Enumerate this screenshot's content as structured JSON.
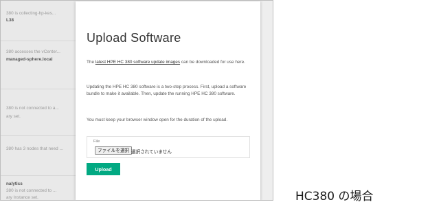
{
  "background_list": {
    "items": [
      {
        "prefix": "",
        "text": "380 is collecting-hp-kes...",
        "strong": "L38"
      },
      {
        "prefix": "",
        "text": "380 accesses the vCenter...",
        "strong": ""
      },
      {
        "prefix": "",
        "text": "",
        "strong": "managed-sphere.local"
      },
      {
        "prefix": "",
        "text": "380 is not connected to a...",
        "strong": ""
      },
      {
        "prefix": "",
        "text": "ary set.",
        "strong": ""
      },
      {
        "prefix": "",
        "text": "380 has 3 nodes that need ...",
        "strong": ""
      },
      {
        "prefix": "",
        "text": "",
        "strong": "nalytics"
      },
      {
        "prefix": "",
        "text": "380 is not connected to ...",
        "strong": ""
      },
      {
        "prefix": "",
        "text": "ary Instance set.",
        "strong": ""
      }
    ]
  },
  "modal": {
    "title": "Upload Software",
    "intro_before": "The ",
    "intro_link": "latest HPE HC 380 software update images",
    "intro_after": " can be downloaded for use here.",
    "paragraph2": "Updating the HPE HC 380 software is a two-step process. First, upload a software bundle to make it available. Then, update the running HPE HC 380 software.",
    "paragraph3": "You must keep your browser window open for the duration of the upload.",
    "file": {
      "label": "File",
      "button_label": "ファイルを選択",
      "status_text": "選択されていません"
    },
    "upload_button": "Upload"
  },
  "caption": "HC380 の場合",
  "colors": {
    "accent": "#01a982",
    "modal_background": "#ffffff",
    "backdrop": "#eeeeee"
  }
}
